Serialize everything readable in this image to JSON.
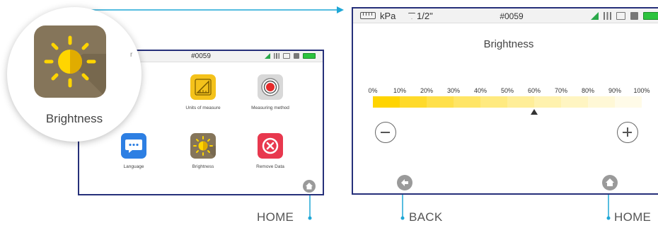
{
  "colors": {
    "frame_border": "#26307a",
    "callout_line": "#1fa7d6",
    "brightness_icon_bg": "#85755a",
    "sun_yellow": "#ffd500"
  },
  "small_device": {
    "device_id": "#0059",
    "apps": [
      {
        "label": "Units of measure",
        "icon": "ruler-triangle-icon"
      },
      {
        "label": "Measuring method",
        "icon": "target-icon"
      },
      {
        "label": "Language",
        "icon": "speech-bubble-icon"
      },
      {
        "label": "Brightness",
        "icon": "sun-icon"
      },
      {
        "label": "Remove Data",
        "icon": "delete-x-icon"
      }
    ],
    "home_icon": "home-icon"
  },
  "magnifier": {
    "label": "Brightness",
    "icon": "sun-icon"
  },
  "large_device": {
    "status": {
      "unit": "kPa",
      "size": "1/2\"",
      "device_id": "#0059"
    },
    "title": "Brightness",
    "percent_labels": [
      "0%",
      "10%",
      "20%",
      "30%",
      "40%",
      "50%",
      "60%",
      "70%",
      "80%",
      "90%",
      "100%"
    ],
    "brightness_level": 0.6,
    "bar_segments": [
      "#ffd400",
      "#ffda2a",
      "#ffe04a",
      "#ffe566",
      "#ffea80",
      "#ffee98",
      "#fff2ae",
      "#fff5c2",
      "#fff8d6",
      "#fffbe8"
    ],
    "minus_icon": "minus-icon",
    "plus_icon": "plus-icon",
    "back_icon": "back-arrow-icon",
    "home_icon": "home-icon"
  },
  "callouts": {
    "home_left": "HOME",
    "back": "BACK",
    "home_right": "HOME"
  }
}
